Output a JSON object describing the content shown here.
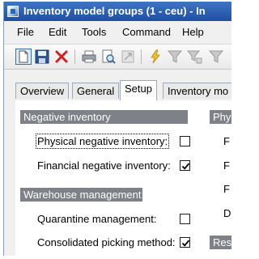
{
  "window": {
    "title": "Inventory model groups (1 - ceu) - In"
  },
  "menu": {
    "items": [
      "File",
      "Edit",
      "Tools",
      "Command",
      "Help"
    ]
  },
  "toolbar": {
    "buttons": [
      "new-icon",
      "save-icon",
      "delete-icon",
      "print-icon",
      "print-preview-icon",
      "zoom-icon",
      "refresh-icon",
      "filter-icon",
      "advanced-filter-icon"
    ]
  },
  "tabs": {
    "items": [
      "Overview",
      "General",
      "Setup",
      "Inventory mo"
    ],
    "active": "Setup"
  },
  "negative_inventory": {
    "header": "Negative inventory",
    "physical_label": "Physical negative inventory:",
    "physical_checked": false,
    "financial_label": "Financial negative inventory:",
    "financial_checked": true
  },
  "warehouse_management": {
    "header": "Warehouse management",
    "quarantine_label": "Quarantine management:",
    "quarantine_checked": false,
    "consolidated_label": "Consolidated picking method:",
    "consolidated_checked": true
  },
  "right_column": {
    "header1": "Phy",
    "letters": [
      "F",
      "F",
      "F",
      "D"
    ],
    "header2": "Res"
  },
  "colors": {
    "titlebar": "#1f4fa3",
    "group_header": "#7e8187"
  }
}
